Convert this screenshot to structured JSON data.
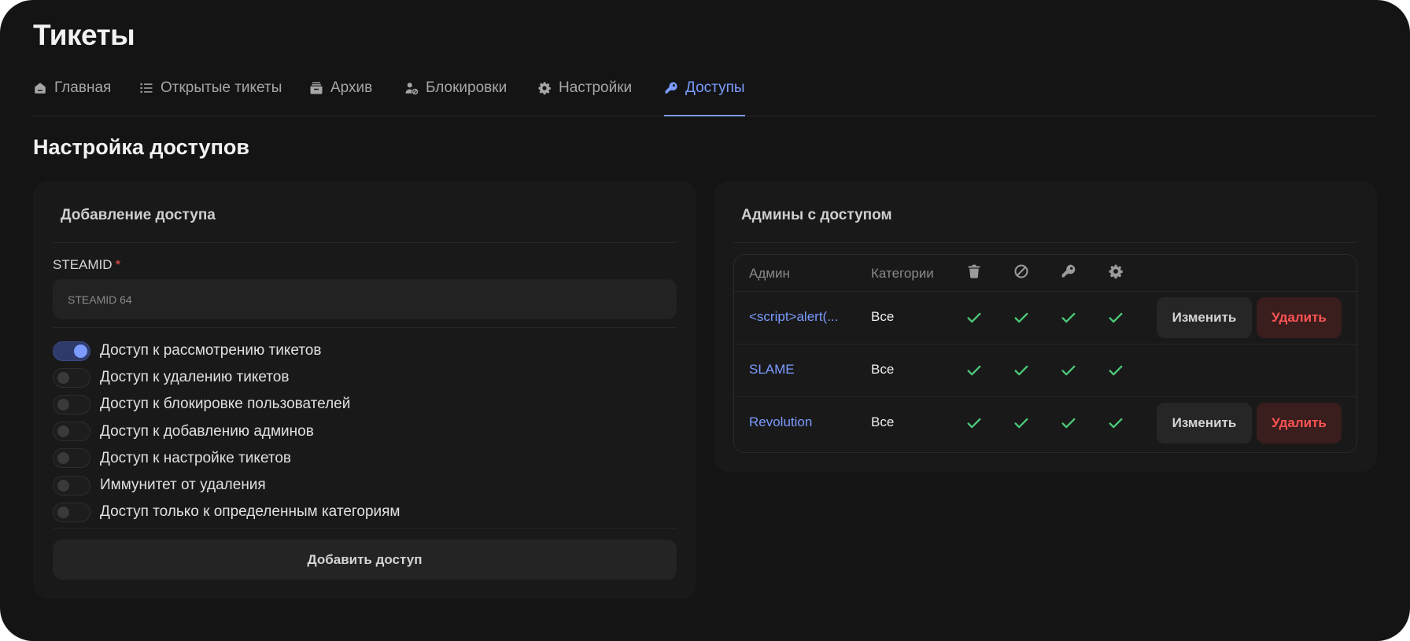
{
  "page": {
    "title": "Тикеты",
    "section_title": "Настройка доступов"
  },
  "tabs": [
    {
      "label": "Главная",
      "icon": "home-icon"
    },
    {
      "label": "Открытые тикеты",
      "icon": "list-icon"
    },
    {
      "label": "Архив",
      "icon": "archive-icon"
    },
    {
      "label": "Блокировки",
      "icon": "user-block-icon"
    },
    {
      "label": "Настройки",
      "icon": "gear-icon"
    },
    {
      "label": "Доступы",
      "icon": "key-icon",
      "active": true
    }
  ],
  "add_access": {
    "title": "Добавление доступа",
    "steamid_label": "STEAMID",
    "required_mark": "*",
    "steamid_placeholder": "STEAMID 64",
    "steamid_value": "",
    "toggles": [
      {
        "label": "Доступ к рассмотрению тикетов",
        "on": true
      },
      {
        "label": "Доступ к удалению тикетов",
        "on": false
      },
      {
        "label": "Доступ к блокировке пользователей",
        "on": false
      },
      {
        "label": "Доступ к добавлению админов",
        "on": false
      },
      {
        "label": "Доступ к настройке тикетов",
        "on": false
      },
      {
        "label": "Иммунитет от удаления",
        "on": false
      },
      {
        "label": "Доступ только к определенным категориям",
        "on": false
      }
    ],
    "submit_label": "Добавить доступ"
  },
  "admins": {
    "title": "Админы с доступом",
    "columns": {
      "admin": "Админ",
      "categories": "Категории",
      "icons": [
        "trash-icon",
        "ban-icon",
        "key-icon",
        "gear-icon"
      ]
    },
    "rows": [
      {
        "name": "<script>alert(...",
        "categories": "Все",
        "checks": [
          true,
          true,
          true,
          true
        ],
        "edit_label": "Изменить",
        "delete_label": "Удалить",
        "has_actions": true
      },
      {
        "name": "SLAME",
        "categories": "Все",
        "checks": [
          true,
          true,
          true,
          true
        ],
        "has_actions": false
      },
      {
        "name": "Revolution",
        "categories": "Все",
        "checks": [
          true,
          true,
          true,
          true
        ],
        "edit_label": "Изменить",
        "delete_label": "Удалить",
        "has_actions": true
      }
    ]
  },
  "colors": {
    "accent": "#7b9bff",
    "check": "#4cc878",
    "danger": "#ff5454",
    "background": "#141414",
    "card": "#191919"
  }
}
